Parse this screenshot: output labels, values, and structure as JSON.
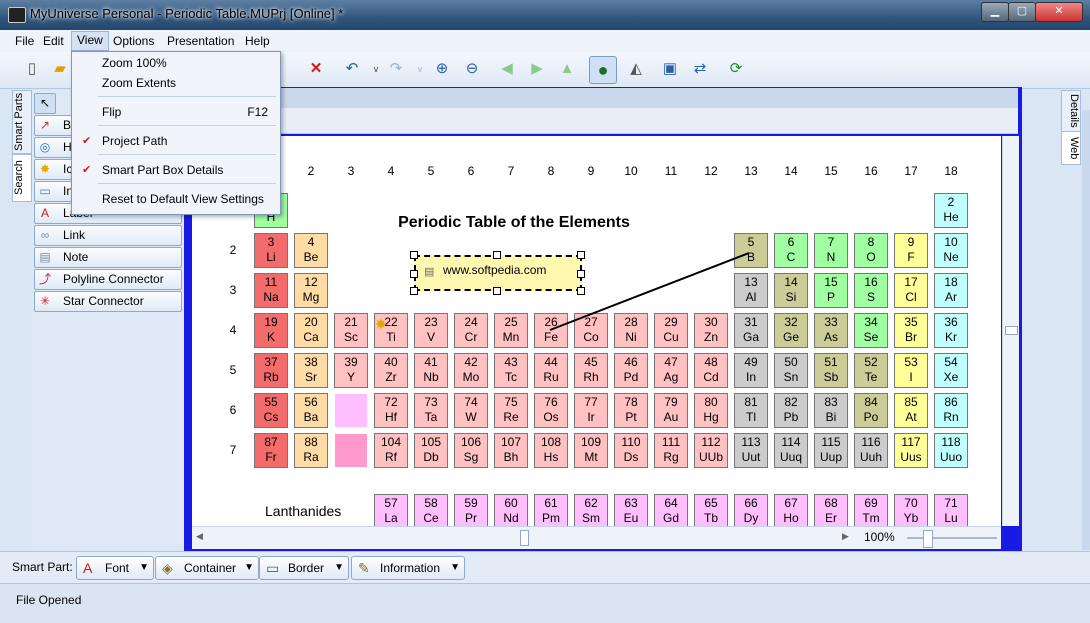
{
  "window": {
    "title": "MyUniverse Personal - Periodic Table.MUPrj [Online] *"
  },
  "menubar": [
    "File",
    "Edit",
    "View",
    "Options",
    "Presentation",
    "Help"
  ],
  "view_menu": {
    "items": [
      {
        "label": "Zoom 100%",
        "shortcut": "",
        "checked": false
      },
      {
        "label": "Zoom Extents",
        "shortcut": "",
        "checked": false
      },
      {
        "label": "Flip",
        "shortcut": "F12",
        "checked": false
      },
      {
        "label": "Project Path",
        "shortcut": "",
        "checked": true
      },
      {
        "label": "Smart Part Box Details",
        "shortcut": "",
        "checked": true
      },
      {
        "label": "Reset to Default View Settings",
        "shortcut": "",
        "checked": false
      }
    ]
  },
  "left_tabs": [
    "Smart Parts",
    "Search"
  ],
  "right_tabs": [
    "Details",
    "Web"
  ],
  "smart_parts": [
    {
      "label": "B",
      "icon": "bezier-connector-icon",
      "color": "#c0392b"
    },
    {
      "label": "H",
      "icon": "hyperlink-icon",
      "color": "#2c6bb5"
    },
    {
      "label": "Ic",
      "icon": "star-burst-icon",
      "color": "#e6a800"
    },
    {
      "label": "In",
      "icon": "image-icon",
      "color": "#4a7ab0"
    },
    {
      "label": "Label",
      "icon": "font-a-icon",
      "color": "#d41818"
    },
    {
      "label": "Link",
      "icon": "chain-link-icon",
      "color": "#7a8aa0"
    },
    {
      "label": "Note",
      "icon": "note-icon",
      "color": "#7a8aa0"
    },
    {
      "label": "Polyline Connector",
      "icon": "polyline-connector-icon",
      "color": "#d41818"
    },
    {
      "label": "Star Connector",
      "icon": "star-connector-icon",
      "color": "#d41818"
    }
  ],
  "canvas": {
    "title": "Periodic Table of the Elements",
    "note_box_text": "www.softpedia.com",
    "lanthanides_label": "Lanthanides",
    "zoom_text": "100%"
  },
  "periodic": {
    "columns": [
      "2",
      "3",
      "4",
      "5",
      "6",
      "7",
      "8",
      "9",
      "10",
      "11",
      "12",
      "13",
      "14",
      "15",
      "16",
      "17",
      "18"
    ],
    "rows": [
      "2",
      "3",
      "4",
      "5",
      "6",
      "7"
    ],
    "colors": {
      "alkali": "#f46b6b",
      "alkaline": "#ffdca6",
      "transition": "#ffc1c1",
      "poor": "#cccccc",
      "metalloid": "#cccc99",
      "nonmetal": "#a0ffa0",
      "halogen": "#ffff99",
      "noble": "#c0ffff",
      "lanth": "#ffbfff",
      "actin": "#ff99cc"
    },
    "elements": [
      [
        "1",
        "H",
        1,
        1,
        "nonmetal"
      ],
      [
        "2",
        "He",
        18,
        1,
        "noble"
      ],
      [
        "3",
        "Li",
        1,
        2,
        "alkali"
      ],
      [
        "4",
        "Be",
        2,
        2,
        "alkaline"
      ],
      [
        "5",
        "B",
        13,
        2,
        "metalloid"
      ],
      [
        "6",
        "C",
        14,
        2,
        "nonmetal"
      ],
      [
        "7",
        "N",
        15,
        2,
        "nonmetal"
      ],
      [
        "8",
        "O",
        16,
        2,
        "nonmetal"
      ],
      [
        "9",
        "F",
        17,
        2,
        "halogen"
      ],
      [
        "10",
        "Ne",
        18,
        2,
        "noble"
      ],
      [
        "11",
        "Na",
        1,
        3,
        "alkali"
      ],
      [
        "12",
        "Mg",
        2,
        3,
        "alkaline"
      ],
      [
        "13",
        "Al",
        13,
        3,
        "poor"
      ],
      [
        "14",
        "Si",
        14,
        3,
        "metalloid"
      ],
      [
        "15",
        "P",
        15,
        3,
        "nonmetal"
      ],
      [
        "16",
        "S",
        16,
        3,
        "nonmetal"
      ],
      [
        "17",
        "Cl",
        17,
        3,
        "halogen"
      ],
      [
        "18",
        "Ar",
        18,
        3,
        "noble"
      ],
      [
        "19",
        "K",
        1,
        4,
        "alkali"
      ],
      [
        "20",
        "Ca",
        2,
        4,
        "alkaline"
      ],
      [
        "21",
        "Sc",
        3,
        4,
        "transition"
      ],
      [
        "22",
        "Ti",
        4,
        4,
        "transition"
      ],
      [
        "23",
        "V",
        5,
        4,
        "transition"
      ],
      [
        "24",
        "Cr",
        6,
        4,
        "transition"
      ],
      [
        "25",
        "Mn",
        7,
        4,
        "transition"
      ],
      [
        "26",
        "Fe",
        8,
        4,
        "transition"
      ],
      [
        "27",
        "Co",
        9,
        4,
        "transition"
      ],
      [
        "28",
        "Ni",
        10,
        4,
        "transition"
      ],
      [
        "29",
        "Cu",
        11,
        4,
        "transition"
      ],
      [
        "30",
        "Zn",
        12,
        4,
        "transition"
      ],
      [
        "31",
        "Ga",
        13,
        4,
        "poor"
      ],
      [
        "32",
        "Ge",
        14,
        4,
        "metalloid"
      ],
      [
        "33",
        "As",
        15,
        4,
        "metalloid"
      ],
      [
        "34",
        "Se",
        16,
        4,
        "nonmetal"
      ],
      [
        "35",
        "Br",
        17,
        4,
        "halogen"
      ],
      [
        "36",
        "Kr",
        18,
        4,
        "noble"
      ],
      [
        "37",
        "Rb",
        1,
        5,
        "alkali"
      ],
      [
        "38",
        "Sr",
        2,
        5,
        "alkaline"
      ],
      [
        "39",
        "Y",
        3,
        5,
        "transition"
      ],
      [
        "40",
        "Zr",
        4,
        5,
        "transition"
      ],
      [
        "41",
        "Nb",
        5,
        5,
        "transition"
      ],
      [
        "42",
        "Mo",
        6,
        5,
        "transition"
      ],
      [
        "43",
        "Tc",
        7,
        5,
        "transition"
      ],
      [
        "44",
        "Ru",
        8,
        5,
        "transition"
      ],
      [
        "45",
        "Rh",
        9,
        5,
        "transition"
      ],
      [
        "46",
        "Pd",
        10,
        5,
        "transition"
      ],
      [
        "47",
        "Ag",
        11,
        5,
        "transition"
      ],
      [
        "48",
        "Cd",
        12,
        5,
        "transition"
      ],
      [
        "49",
        "In",
        13,
        5,
        "poor"
      ],
      [
        "50",
        "Sn",
        14,
        5,
        "poor"
      ],
      [
        "51",
        "Sb",
        15,
        5,
        "metalloid"
      ],
      [
        "52",
        "Te",
        16,
        5,
        "metalloid"
      ],
      [
        "53",
        "I",
        17,
        5,
        "halogen"
      ],
      [
        "54",
        "Xe",
        18,
        5,
        "noble"
      ],
      [
        "55",
        "Cs",
        1,
        6,
        "alkali"
      ],
      [
        "56",
        "Ba",
        2,
        6,
        "alkaline"
      ],
      [
        "",
        "",
        3,
        6,
        "lanth"
      ],
      [
        "72",
        "Hf",
        4,
        6,
        "transition"
      ],
      [
        "73",
        "Ta",
        5,
        6,
        "transition"
      ],
      [
        "74",
        "W",
        6,
        6,
        "transition"
      ],
      [
        "75",
        "Re",
        7,
        6,
        "transition"
      ],
      [
        "76",
        "Os",
        8,
        6,
        "transition"
      ],
      [
        "77",
        "Ir",
        9,
        6,
        "transition"
      ],
      [
        "78",
        "Pt",
        10,
        6,
        "transition"
      ],
      [
        "79",
        "Au",
        11,
        6,
        "transition"
      ],
      [
        "80",
        "Hg",
        12,
        6,
        "transition"
      ],
      [
        "81",
        "Tl",
        13,
        6,
        "poor"
      ],
      [
        "82",
        "Pb",
        14,
        6,
        "poor"
      ],
      [
        "83",
        "Bi",
        15,
        6,
        "poor"
      ],
      [
        "84",
        "Po",
        16,
        6,
        "metalloid"
      ],
      [
        "85",
        "At",
        17,
        6,
        "halogen"
      ],
      [
        "86",
        "Rn",
        18,
        6,
        "noble"
      ],
      [
        "87",
        "Fr",
        1,
        7,
        "alkali"
      ],
      [
        "88",
        "Ra",
        2,
        7,
        "alkaline"
      ],
      [
        "",
        "",
        3,
        7,
        "actin"
      ],
      [
        "104",
        "Rf",
        4,
        7,
        "transition"
      ],
      [
        "105",
        "Db",
        5,
        7,
        "transition"
      ],
      [
        "106",
        "Sg",
        6,
        7,
        "transition"
      ],
      [
        "107",
        "Bh",
        7,
        7,
        "transition"
      ],
      [
        "108",
        "Hs",
        8,
        7,
        "transition"
      ],
      [
        "109",
        "Mt",
        9,
        7,
        "transition"
      ],
      [
        "110",
        "Ds",
        10,
        7,
        "transition"
      ],
      [
        "111",
        "Rg",
        11,
        7,
        "transition"
      ],
      [
        "112",
        "UUb",
        12,
        7,
        "transition"
      ],
      [
        "113",
        "Uut",
        13,
        7,
        "poor"
      ],
      [
        "114",
        "Uuq",
        14,
        7,
        "poor"
      ],
      [
        "115",
        "Uup",
        15,
        7,
        "poor"
      ],
      [
        "116",
        "Uuh",
        16,
        7,
        "poor"
      ],
      [
        "117",
        "Uus",
        17,
        7,
        "halogen"
      ],
      [
        "118",
        "Uuo",
        18,
        7,
        "noble"
      ],
      [
        "57",
        "La",
        4,
        8,
        "lanth"
      ],
      [
        "58",
        "Ce",
        5,
        8,
        "lanth"
      ],
      [
        "59",
        "Pr",
        6,
        8,
        "lanth"
      ],
      [
        "60",
        "Nd",
        7,
        8,
        "lanth"
      ],
      [
        "61",
        "Pm",
        8,
        8,
        "lanth"
      ],
      [
        "62",
        "Sm",
        9,
        8,
        "lanth"
      ],
      [
        "63",
        "Eu",
        10,
        8,
        "lanth"
      ],
      [
        "64",
        "Gd",
        11,
        8,
        "lanth"
      ],
      [
        "65",
        "Tb",
        12,
        8,
        "lanth"
      ],
      [
        "66",
        "Dy",
        13,
        8,
        "lanth"
      ],
      [
        "67",
        "Ho",
        14,
        8,
        "lanth"
      ],
      [
        "68",
        "Er",
        15,
        8,
        "lanth"
      ],
      [
        "69",
        "Tm",
        16,
        8,
        "lanth"
      ],
      [
        "70",
        "Yb",
        17,
        8,
        "lanth"
      ],
      [
        "71",
        "Lu",
        18,
        8,
        "lanth"
      ]
    ]
  },
  "smart_part_bar": {
    "label": "Smart Part:",
    "buttons": [
      {
        "label": "Font",
        "icon": "font-a-icon"
      },
      {
        "label": "Container",
        "icon": "box-icon"
      },
      {
        "label": "Border",
        "icon": "border-icon"
      },
      {
        "label": "Information",
        "icon": "info-note-icon"
      }
    ]
  },
  "status": {
    "text": "File Opened"
  }
}
